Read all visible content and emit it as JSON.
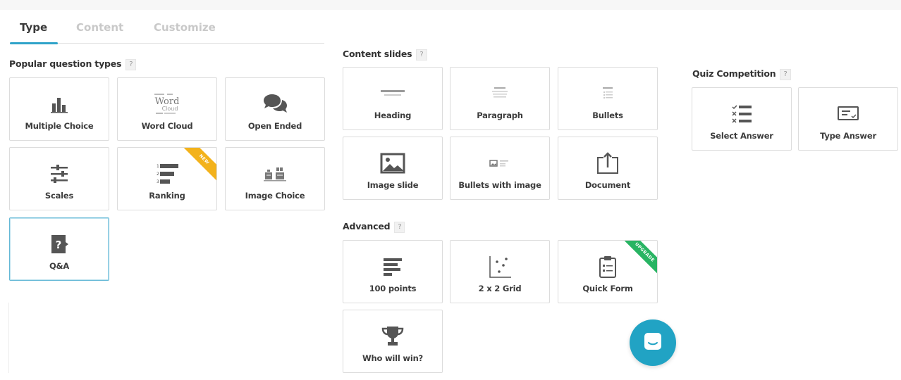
{
  "tabs": [
    {
      "label": "Type",
      "active": true
    },
    {
      "label": "Content",
      "active": false
    },
    {
      "label": "Customize",
      "active": false
    }
  ],
  "help_mark": "?",
  "sections": {
    "popular": {
      "title": "Popular question types",
      "cards": [
        {
          "label": "Multiple Choice",
          "icon": "bar-chart-icon"
        },
        {
          "label": "Word Cloud",
          "icon": "word-cloud-icon"
        },
        {
          "label": "Open Ended",
          "icon": "speech-bubbles-icon"
        },
        {
          "label": "Scales",
          "icon": "sliders-icon"
        },
        {
          "label": "Ranking",
          "icon": "ranking-icon",
          "ribbon": "NEW"
        },
        {
          "label": "Image Choice",
          "icon": "image-choice-icon"
        },
        {
          "label": "Q&A",
          "icon": "question-flag-icon",
          "selected": true
        }
      ]
    },
    "content_slides": {
      "title": "Content slides",
      "cards": [
        {
          "label": "Heading",
          "icon": "heading-preview-icon"
        },
        {
          "label": "Paragraph",
          "icon": "paragraph-preview-icon"
        },
        {
          "label": "Bullets",
          "icon": "bullets-preview-icon"
        },
        {
          "label": "Image slide",
          "icon": "image-icon"
        },
        {
          "label": "Bullets with image",
          "icon": "bullets-image-icon"
        },
        {
          "label": "Document",
          "icon": "document-upload-icon"
        }
      ]
    },
    "advanced": {
      "title": "Advanced",
      "cards": [
        {
          "label": "100 points",
          "icon": "points-bars-icon"
        },
        {
          "label": "2 x 2 Grid",
          "icon": "scatter-grid-icon"
        },
        {
          "label": "Quick Form",
          "icon": "clipboard-form-icon",
          "ribbon": "UPGRADE"
        },
        {
          "label": "Who will win?",
          "icon": "trophy-icon"
        }
      ]
    },
    "quiz": {
      "title": "Quiz Competition",
      "cards": [
        {
          "label": "Select Answer",
          "icon": "select-answer-icon"
        },
        {
          "label": "Type Answer",
          "icon": "type-answer-icon"
        }
      ]
    }
  },
  "colors": {
    "accent": "#2fa3c9",
    "chat_button": "#21a3c4",
    "ribbon_new": "#f3b21b",
    "ribbon_upgrade": "#28b463",
    "icon_gray": "#555555"
  }
}
